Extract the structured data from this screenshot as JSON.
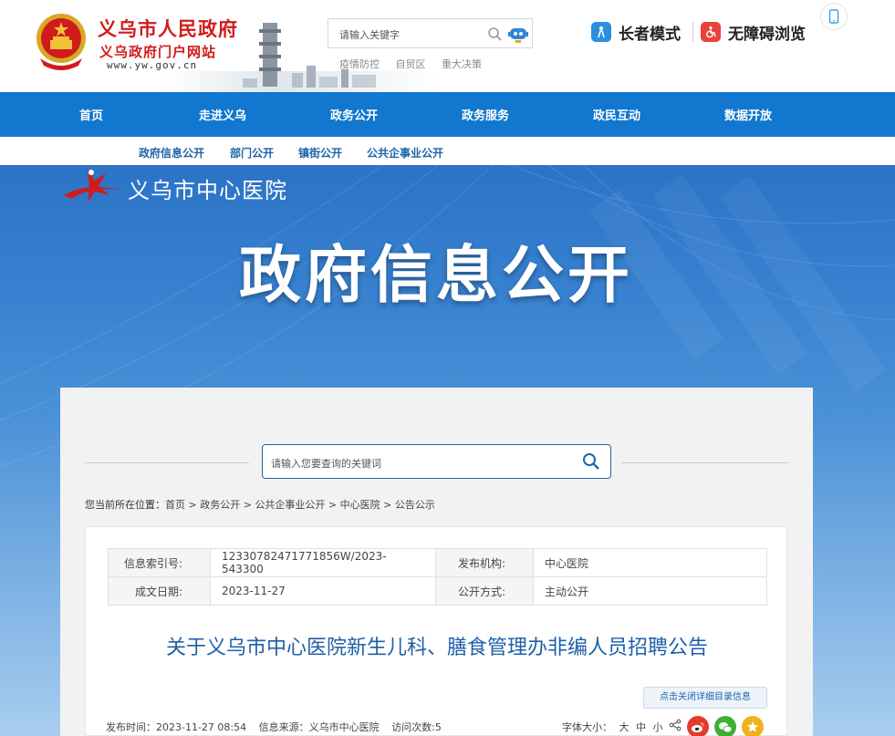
{
  "header": {
    "site_title": "义乌市人民政府",
    "site_subtitle": "义乌政府门户网站",
    "site_url": "www.yw.gov.cn",
    "search_placeholder": "请输入关键字",
    "hot_links": [
      "疫情防控",
      "自贸区",
      "重大决策"
    ],
    "elder_mode": "长者模式",
    "accessible_mode": "无障碍浏览"
  },
  "main_nav": [
    "首页",
    "走进义乌",
    "政务公开",
    "政务服务",
    "政民互动",
    "数据开放"
  ],
  "sub_nav": [
    "政府信息公开",
    "部门公开",
    "镇街公开",
    "公共企事业公开"
  ],
  "banner": {
    "org_name": "义乌市中心医院",
    "title": "政府信息公开"
  },
  "content": {
    "search_placeholder": "请输入您要查询的关键词",
    "breadcrumb_label": "您当前所在位置：",
    "breadcrumb": [
      "首页",
      "政务公开",
      "公共企事业公开",
      "中心医院",
      "公告公示"
    ],
    "meta": {
      "index_label": "信息索引号:",
      "index_value": "12330782471771856W/2023-543300",
      "publisher_label": "发布机构:",
      "publisher_value": "中心医院",
      "date_label": "成文日期:",
      "date_value": "2023-11-27",
      "method_label": "公开方式:",
      "method_value": "主动公开"
    },
    "doc_title": "关于义乌市中心医院新生儿科、膳食管理办非编人员招聘公告",
    "detail_button": "点击关闭详细目录信息",
    "publish_time": "发布时间：2023-11-27 08:54",
    "source": "信息来源：义乌市中心医院",
    "visits": "访问次数:5",
    "font_size_label": "字体大小：",
    "font_sizes": [
      "大",
      "中",
      "小"
    ]
  },
  "colors": {
    "nav_blue": "#1177cf",
    "title_red": "#d11b1b",
    "link_blue": "#1e63a8"
  }
}
